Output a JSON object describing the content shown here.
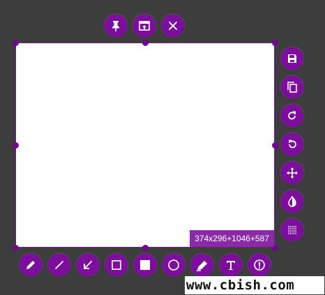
{
  "selection": {
    "size_readout": "374x296+1046+587"
  },
  "toolbar_top": [
    {
      "name": "pin-button",
      "icon": "pin-icon"
    },
    {
      "name": "open-editor-button",
      "icon": "window-arrow-icon"
    },
    {
      "name": "close-button",
      "icon": "close-icon"
    }
  ],
  "toolbar_right": [
    {
      "name": "save-button",
      "icon": "save-icon"
    },
    {
      "name": "copy-button",
      "icon": "copy-icon"
    },
    {
      "name": "redo-button",
      "icon": "redo-icon"
    },
    {
      "name": "undo-button",
      "icon": "undo-icon"
    },
    {
      "name": "move-button",
      "icon": "move-icon"
    },
    {
      "name": "blur-button",
      "icon": "drop-icon"
    },
    {
      "name": "mosaic-button",
      "icon": "mosaic-icon"
    }
  ],
  "toolbar_bottom": [
    {
      "name": "pencil-tool-button",
      "icon": "pencil-icon"
    },
    {
      "name": "line-tool-button",
      "icon": "line-icon"
    },
    {
      "name": "arrow-tool-button",
      "icon": "arrow-icon"
    },
    {
      "name": "rectangle-tool-button",
      "icon": "rectangle-outline-icon"
    },
    {
      "name": "filled-rectangle-tool-button",
      "icon": "rectangle-filled-icon"
    },
    {
      "name": "ellipse-tool-button",
      "icon": "circle-icon"
    },
    {
      "name": "marker-tool-button",
      "icon": "marker-icon"
    },
    {
      "name": "text-tool-button",
      "icon": "text-icon"
    },
    {
      "name": "counter-tool-button",
      "icon": "counter-icon"
    }
  ],
  "watermark": "www.cbish.com",
  "colors": {
    "background": "#3d3d3d",
    "accent": "#7b0f9b",
    "canvas": "#ffffff"
  }
}
